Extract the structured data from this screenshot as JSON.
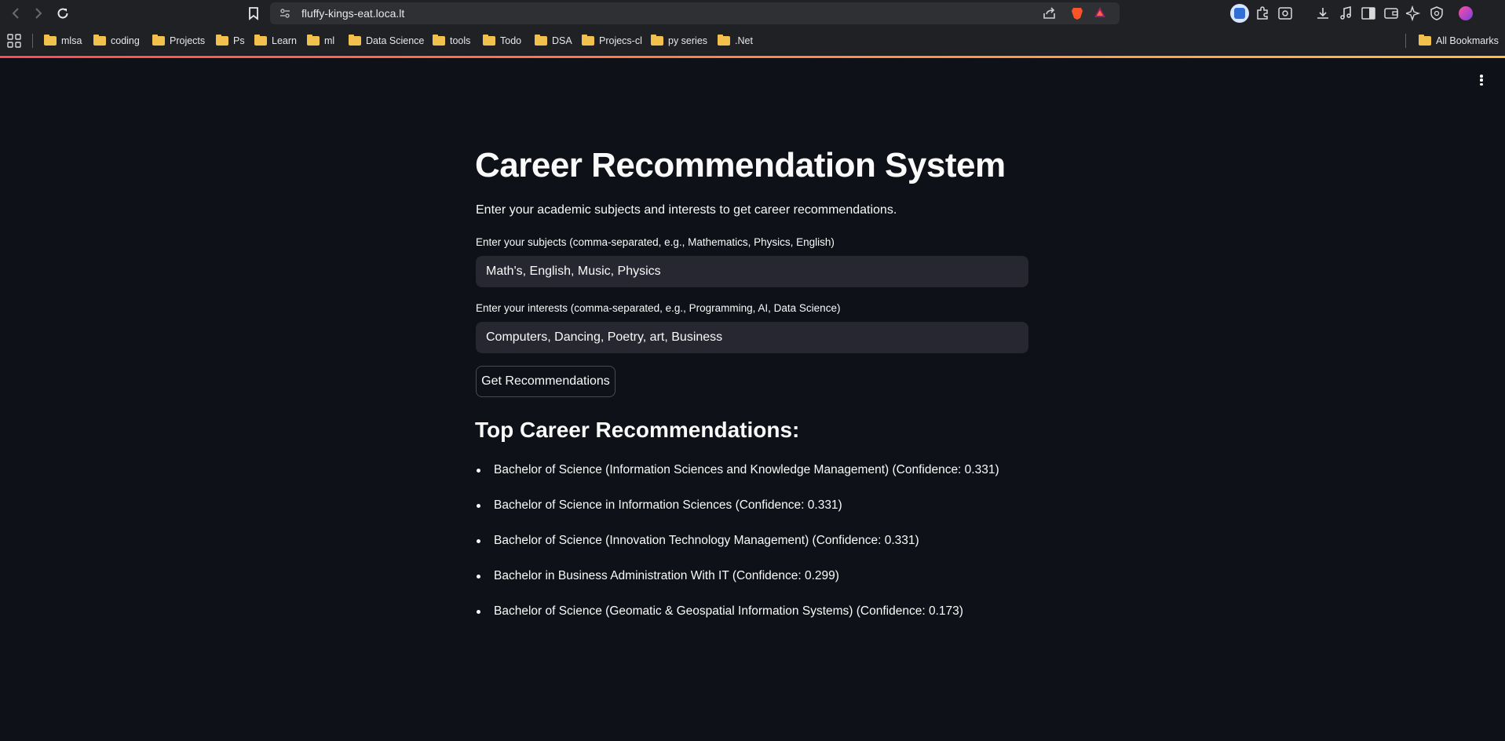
{
  "browser": {
    "url": "fluffy-kings-eat.loca.lt",
    "bookmarks": [
      "mlsa",
      "coding",
      "Projects",
      "Ps",
      "Learn",
      "ml",
      "Data Science",
      "tools",
      "Todo",
      "DSA",
      "Projecs-cl",
      "py series",
      ".Net"
    ],
    "all_bookmarks_label": "All Bookmarks"
  },
  "app": {
    "title": "Career Recommendation System",
    "subtitle": "Enter your academic subjects and interests to get career recommendations.",
    "subjects_label": "Enter your subjects (comma-separated, e.g., Mathematics, Physics, English)",
    "subjects_value": "Math's, English, Music, Physics",
    "interests_label": "Enter your interests (comma-separated, e.g., Programming, AI, Data Science)",
    "interests_value": "Computers, Dancing, Poetry, art, Business",
    "button_label": "Get Recommendations",
    "results_heading": "Top Career Recommendations:",
    "recommendations": [
      "Bachelor of Science (Information Sciences and Knowledge Management) (Confidence: 0.331)",
      "Bachelor of Science in Information Sciences (Confidence: 0.331)",
      "Bachelor of Science (Innovation Technology Management) (Confidence: 0.331)",
      "Bachelor in Business Administration With IT (Confidence: 0.299)",
      "Bachelor of Science (Geomatic & Geospatial Information Systems) (Confidence: 0.173)"
    ]
  },
  "colors": {
    "background": "#0e1117",
    "input_bg": "#262730",
    "text": "#fafafa",
    "accent_start": "#ff4b4b",
    "accent_end": "#ffbd45"
  }
}
